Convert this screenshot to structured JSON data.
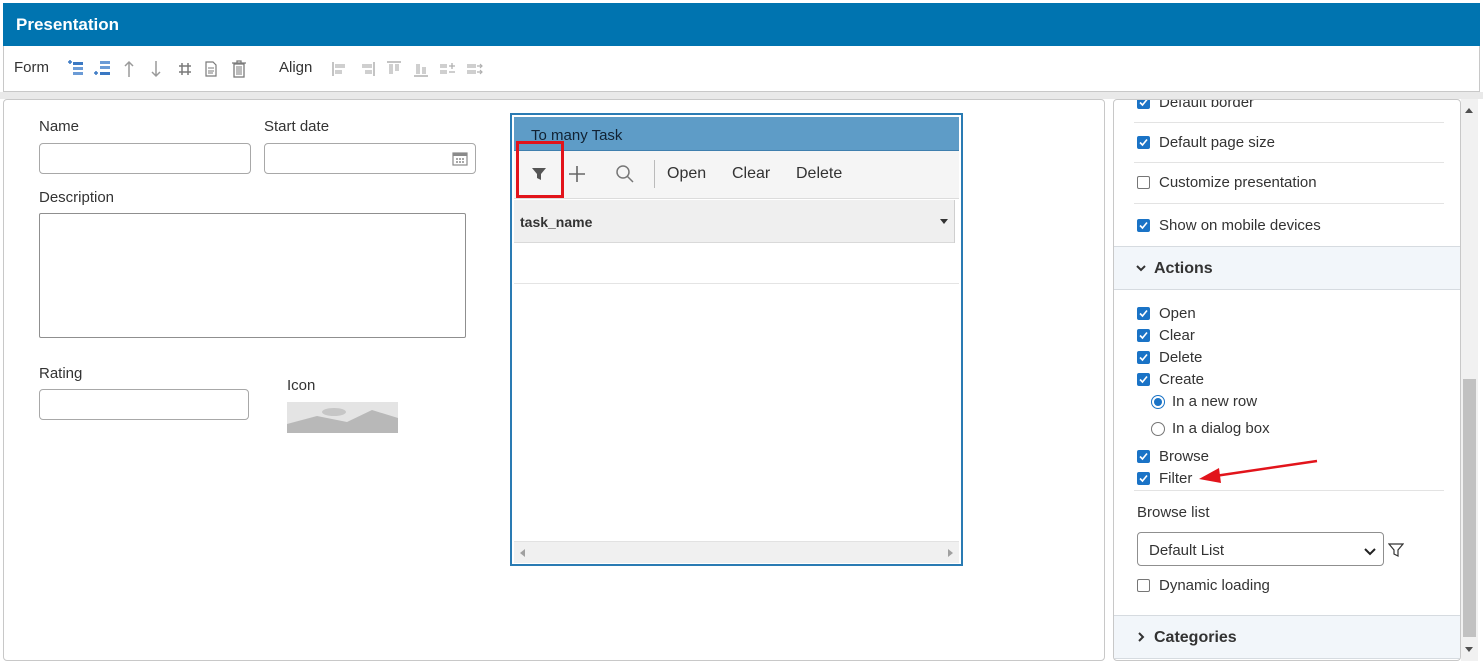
{
  "window": {
    "title": "Presentation"
  },
  "toolbar": {
    "form_label": "Form",
    "align_label": "Align",
    "form_icons": [
      "add-field-icon",
      "insert-field-icon",
      "move-up-icon",
      "move-down-icon",
      "grid-icon",
      "document-icon",
      "trash-icon"
    ],
    "align_icons": [
      "align-left-icon",
      "align-right-icon",
      "align-top-icon",
      "align-bottom-icon",
      "distribute-horizontal-icon",
      "distribute-right-icon"
    ]
  },
  "form": {
    "name_label": "Name",
    "name_value": "",
    "start_date_label": "Start date",
    "start_date_value": "",
    "description_label": "Description",
    "description_value": "",
    "rating_label": "Rating",
    "rating_value": "",
    "icon_label": "Icon"
  },
  "grid": {
    "title": "To many Task",
    "buttons": {
      "open": "Open",
      "clear": "Clear",
      "delete": "Delete"
    },
    "columns": [
      "task_name"
    ]
  },
  "panel": {
    "options_top": [
      {
        "label": "Default border",
        "checked": true
      },
      {
        "label": "Default page size",
        "checked": true
      },
      {
        "label": "Customize presentation",
        "checked": false
      },
      {
        "label": "Show on mobile devices",
        "checked": true
      }
    ],
    "actions_title": "Actions",
    "actions": [
      {
        "label": "Open",
        "checked": true
      },
      {
        "label": "Clear",
        "checked": true
      },
      {
        "label": "Delete",
        "checked": true
      },
      {
        "label": "Create",
        "checked": true
      }
    ],
    "create_modes": [
      {
        "label": "In a new row",
        "selected": true
      },
      {
        "label": "In a dialog box",
        "selected": false
      }
    ],
    "browse_label": "Browse",
    "filter_label": "Filter",
    "browse_list_label": "Browse list",
    "browse_list_value": "Default List",
    "dynamic_loading_label": "Dynamic loading",
    "categories_title": "Categories"
  },
  "colors": {
    "titlebar": "#0074b0",
    "checkbox": "#1a73c6",
    "highlight": "#e2141b"
  }
}
